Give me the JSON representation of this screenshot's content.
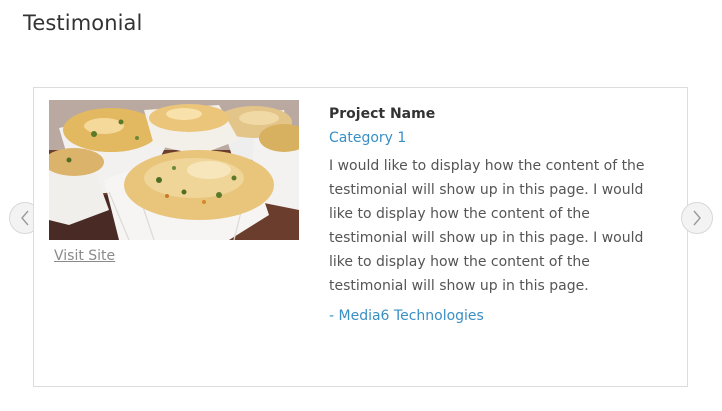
{
  "section": {
    "title": "Testimonial"
  },
  "testimonial": {
    "project_name": "Project Name",
    "category": "Category 1",
    "body": "I would like to display how the content of the testimonial will show up in this page. I would like to display how the content of the testimonial will show up in this page. I would like to display how the content of the testimonial will show up in this page.",
    "author": "- Media6 Technologies",
    "visit_site_label": "Visit Site",
    "image_subject": "baked pastries in paper cups"
  },
  "carousel": {
    "prev_icon": "chevron-left-icon",
    "next_icon": "chevron-right-icon"
  },
  "colors": {
    "link": "#3a8fc4",
    "border": "#dcdcdc",
    "title": "#333333",
    "body_text": "#555555"
  }
}
